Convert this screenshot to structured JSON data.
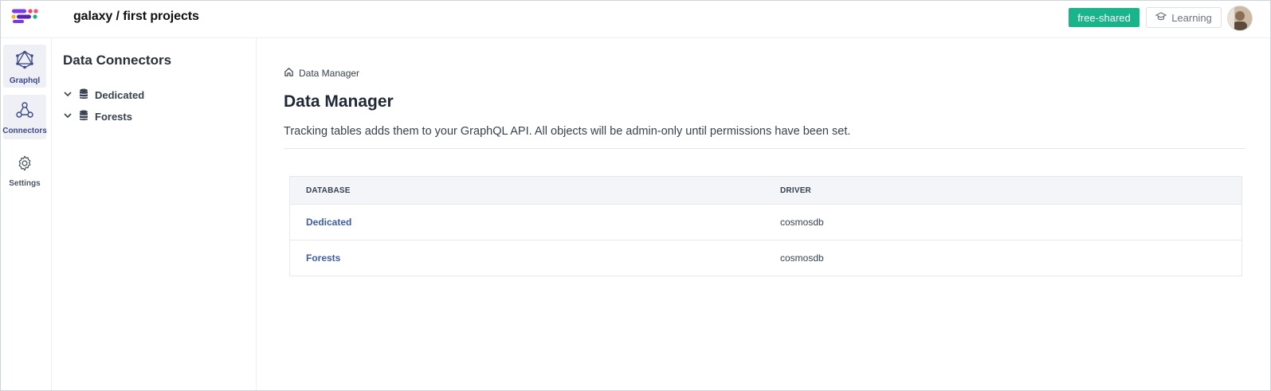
{
  "header": {
    "project_title": "galaxy  / first projects",
    "plan_label": "free-shared",
    "learning_label": "Learning",
    "colors": {
      "plan": "#19b48a",
      "accent": "#3b4a8f"
    }
  },
  "rail": {
    "items": [
      {
        "label": "Graphql",
        "icon": "graphql-icon",
        "active": true
      },
      {
        "label": "Connectors",
        "icon": "connectors-icon",
        "active": true
      },
      {
        "label": "Settings",
        "icon": "gear-icon",
        "active": false
      }
    ]
  },
  "tree": {
    "title": "Data Connectors",
    "items": [
      {
        "label": "Dedicated",
        "icon": "database-icon"
      },
      {
        "label": "Forests",
        "icon": "database-icon"
      }
    ]
  },
  "main": {
    "breadcrumb": "Data Manager",
    "title": "Data Manager",
    "description": "Tracking tables adds them to your GraphQL API. All objects will be admin-only until permissions have been set.",
    "table": {
      "headers": [
        "DATABASE",
        "DRIVER"
      ],
      "rows": [
        {
          "database": "Dedicated",
          "driver": "cosmosdb"
        },
        {
          "database": "Forests",
          "driver": "cosmosdb"
        }
      ]
    }
  }
}
